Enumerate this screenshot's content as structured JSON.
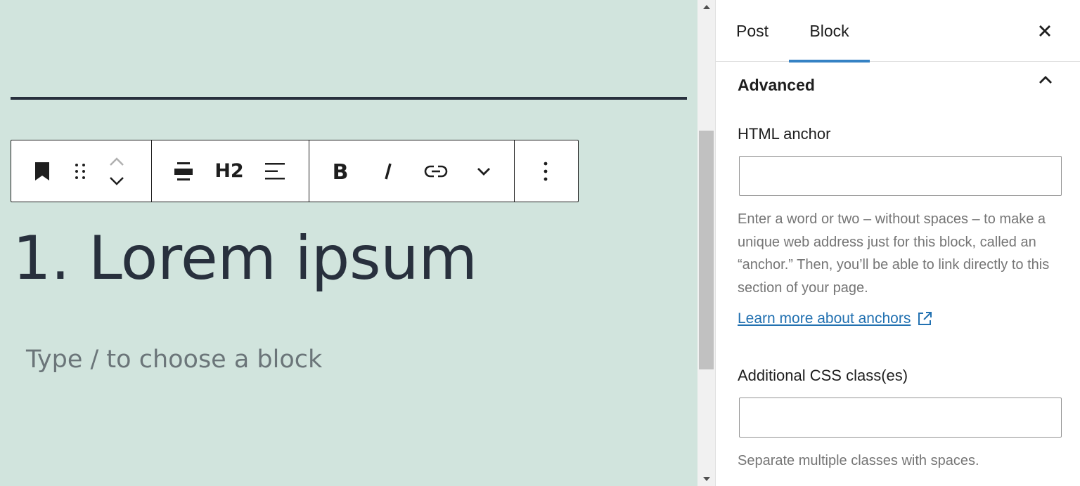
{
  "editor": {
    "toolbar": {
      "block_type_icon": "bookmark-icon",
      "drag_handle_icon": "drag-handle-icon",
      "heading_level_label": "H2",
      "icons": [
        "bookmark-icon",
        "drag-handle-icon",
        "chevron-up-icon",
        "chevron-down-icon",
        "align-icon",
        "text-align-icon",
        "bold-icon",
        "italic-icon",
        "link-icon",
        "chevron-down-icon",
        "more-vertical-icon"
      ]
    },
    "heading_text": "1. Lorem ipsum",
    "block_placeholder": "Type / to choose a block",
    "colors": {
      "background": "#d1e4dd",
      "text": "#28303d",
      "placeholder": "#6b7579"
    }
  },
  "sidebar": {
    "tabs": [
      {
        "label": "Post",
        "active": false
      },
      {
        "label": "Block",
        "active": true
      }
    ],
    "close_icon": "close-icon",
    "panel": {
      "title": "Advanced",
      "expanded": true,
      "html_anchor": {
        "label": "HTML anchor",
        "value": "",
        "help": "Enter a word or two – without spaces – to make a unique web address just for this block, called an “anchor.” Then, you’ll be able to link directly to this section of your page.",
        "link_text": "Learn more about anchors"
      },
      "css_classes": {
        "label": "Additional CSS class(es)",
        "value": "",
        "help": "Separate multiple classes with spaces."
      }
    },
    "colors": {
      "accent": "#3582c4",
      "link": "#2271b1",
      "help_text": "#757575"
    }
  }
}
